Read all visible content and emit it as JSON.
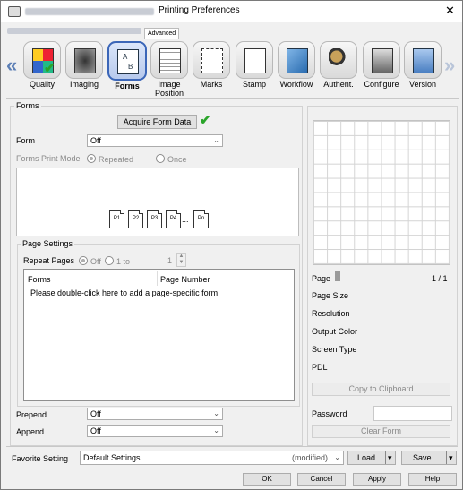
{
  "window": {
    "title": "Printing Preferences",
    "close": "✕",
    "tab": "Advanced"
  },
  "toolbar": {
    "items": [
      {
        "label": "Quality",
        "icon": "quality-icon"
      },
      {
        "label": "Imaging",
        "icon": "imaging-icon"
      },
      {
        "label": "Forms",
        "icon": "forms-icon",
        "selected": true
      },
      {
        "label": "Image\nPosition",
        "icon": "image-position-icon"
      },
      {
        "label": "Marks",
        "icon": "marks-icon"
      },
      {
        "label": "Stamp",
        "icon": "stamp-icon"
      },
      {
        "label": "Workflow",
        "icon": "workflow-icon"
      },
      {
        "label": "Authent.",
        "icon": "authentication-icon"
      },
      {
        "label": "Configure",
        "icon": "configure-icon"
      },
      {
        "label": "Version",
        "icon": "version-icon"
      }
    ],
    "prev": "«",
    "next": "»"
  },
  "forms": {
    "group_title": "Forms",
    "acquire_button": "Acquire Form Data",
    "form_label": "Form",
    "form_value": "Off",
    "print_mode_label": "Forms Print Mode",
    "mode_repeated": "Repeated",
    "mode_once": "Once",
    "pages": [
      "P1",
      "P2",
      "P3",
      "P4",
      "...",
      "Pn"
    ]
  },
  "page_settings": {
    "title": "Page Settings",
    "repeat_label": "Repeat Pages",
    "off_label": "Off",
    "range_label": "1 to",
    "range_value": "1",
    "col_forms": "Forms",
    "col_page": "Page Number",
    "hint": "Please double-click here to add a page-specific form"
  },
  "prepend": {
    "label": "Prepend",
    "value": "Off"
  },
  "append": {
    "label": "Append",
    "value": "Off"
  },
  "info": {
    "page_label": "Page",
    "page_value": "1 / 1",
    "page_size": "Page Size",
    "resolution": "Resolution",
    "output_color": "Output Color",
    "screen_type": "Screen Type",
    "pdl": "PDL",
    "copy_button": "Copy to Clipboard",
    "password_label": "Password",
    "clear_button": "Clear Form"
  },
  "favorite": {
    "label": "Favorite Setting",
    "value": "Default Settings",
    "modified": "(modified)",
    "load": "Load",
    "save": "Save"
  },
  "dialog": {
    "ok": "OK",
    "cancel": "Cancel",
    "apply": "Apply",
    "help": "Help"
  },
  "colors": {
    "accent": "#3b66b8",
    "check": "#2aa52a"
  }
}
